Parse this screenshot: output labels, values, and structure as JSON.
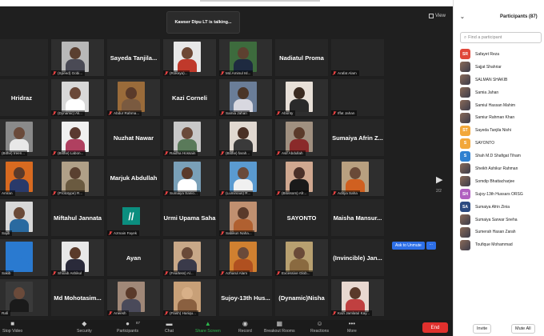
{
  "stage": {
    "talking": "Kawser Dipu LT is talking...",
    "view_label": "View",
    "page_count": "2/2",
    "ask_to_unmute": "Ask to Unmute",
    "more": "..."
  },
  "tiles": [
    {
      "name": "",
      "type": "blank"
    },
    {
      "name": "(Speed) Gobi...",
      "type": "photo",
      "bg": "#b8b8b8",
      "head": "#5a3f30",
      "body": "#4a4a55"
    },
    {
      "name": "Sayeda Tanjila...",
      "type": "text"
    },
    {
      "name": "(Rokeya)...",
      "type": "photo",
      "bg": "#e8e8e8",
      "head": "#6d4835",
      "body": "#c0392b"
    },
    {
      "name": "Md.Aminul Isl...",
      "type": "photo",
      "bg": "#3d6b3d",
      "head": "#5d4030",
      "body": "#1e2a40"
    },
    {
      "name": "Nadiatul Proma",
      "type": "text"
    },
    {
      "name": "Arafat Alam",
      "type": "blank"
    },
    {
      "name": "Hridraz",
      "type": "text"
    },
    {
      "name": "(Dynamic) Ali...",
      "type": "photo",
      "bg": "#d8d8d8",
      "head": "#6a4838",
      "body": "#ffffff"
    },
    {
      "name": "Abdur Rahma...",
      "type": "photo",
      "bg": "#9a6b3a",
      "head": "#5a3a2a",
      "body": "#7a5a40"
    },
    {
      "name": "Kazi Corneli",
      "type": "text"
    },
    {
      "name": "Samia Jahan",
      "type": "photo",
      "bg": "#6a7d98",
      "head": "#4a3528",
      "body": "#d8d8e0"
    },
    {
      "name": "Abonty",
      "type": "photo",
      "bg": "#e8e0d8",
      "head": "#3a2a20",
      "body": "#2a2a2a"
    },
    {
      "name": "Iffat Jahan",
      "type": "blank"
    },
    {
      "name": "(Bithe) Ireen...",
      "type": "photo",
      "bg": "#8a8a8a",
      "head": "#6a4a3a",
      "body": "#e8e8e8"
    },
    {
      "name": "(Blithe) Labon...",
      "type": "photo",
      "bg": "#f0f0f0",
      "head": "#5a3a30",
      "body": "#b04060"
    },
    {
      "name": "Nuzhat Nawar",
      "type": "text"
    },
    {
      "name": "Raidha Hossain",
      "type": "photo",
      "bg": "#c8c8c8",
      "head": "#6a4a3a",
      "body": "#5a7a5a"
    },
    {
      "name": "(Blithe) farah...",
      "type": "photo",
      "bg": "#e0d8d0",
      "head": "#4a3025",
      "body": "#3a3a3a"
    },
    {
      "name": "Asif Abdullah",
      "type": "photo",
      "bg": "#a09080",
      "head": "#5a3a2a",
      "body": "#8a2a2a"
    },
    {
      "name": "Sumaiya Afrin Z...",
      "type": "text"
    },
    {
      "name": "Amran",
      "type": "photo",
      "bg": "#d86a20",
      "head": "#5a3a2a",
      "body": "#2a3a6a"
    },
    {
      "name": "(Prototype) R...",
      "type": "photo",
      "bg": "#b0a088",
      "head": "#5a4030",
      "body": "#6a5a40"
    },
    {
      "name": "Marjuk Abdullah",
      "type": "text"
    },
    {
      "name": "Sumaiya Sanio...",
      "type": "photo",
      "bg": "#7aa0b8",
      "head": "#5a3a2a",
      "body": "#ffffff"
    },
    {
      "name": "(Luminous) R...",
      "type": "photo",
      "bg": "#5a9ad0",
      "head": "#6a4a3a",
      "body": "#f0f0f0"
    },
    {
      "name": "(Blossom) Afr...",
      "type": "photo",
      "bg": "#d0a890",
      "head": "#4a3028",
      "body": "#1a1a1a"
    },
    {
      "name": "Aditya Saha",
      "type": "photo",
      "bg": "#b8a080",
      "head": "#6a4a38",
      "body": "#d06020"
    },
    {
      "name": "Sajib",
      "type": "photo",
      "bg": "#d8d8d8",
      "head": "#6a4a38",
      "body": "#2a6aa0"
    },
    {
      "name": "Miftahul Jannata",
      "type": "text"
    },
    {
      "name": "Azmain Fayek",
      "type": "logo"
    },
    {
      "name": "Urmi Upama Saha",
      "type": "text"
    },
    {
      "name": "Sabikun Naha...",
      "type": "photo",
      "bg": "#c09070",
      "head": "#5a3a2a",
      "body": "#b06030"
    },
    {
      "name": "SAYONTO",
      "type": "text"
    },
    {
      "name": "Maisha Mansur...",
      "type": "text"
    },
    {
      "name": "Sakib",
      "type": "photo",
      "bg": "#2a7ad0",
      "head": "#2a7ad0",
      "body": "#2a7ad0"
    },
    {
      "name": "Shoaib Ashikul",
      "type": "photo",
      "bg": "#e8e8e8",
      "head": "#5a3a2a",
      "body": "#2a2a3a"
    },
    {
      "name": "Ayan",
      "type": "text"
    },
    {
      "name": "(Fearless) Al...",
      "type": "photo",
      "bg": "#c8a888",
      "head": "#6a4a38",
      "body": "#3a3a4a"
    },
    {
      "name": "Azharul Alam",
      "type": "photo",
      "bg": "#d08030",
      "head": "#6a4a3a",
      "body": "#b05020"
    },
    {
      "name": "Excessive Glob...",
      "type": "photo",
      "bg": "#b8a070",
      "head": "#6a4a38",
      "body": "#8a6a40"
    },
    {
      "name": "(Invincible) Jan...",
      "type": "text"
    },
    {
      "name": "Rafi",
      "type": "photo",
      "bg": "#3a3a3a",
      "head": "#6a4a3a",
      "body": "#1a1a1a"
    },
    {
      "name": "Md Mohotasim...",
      "type": "text"
    },
    {
      "name": "Aneesh",
      "type": "photo",
      "bg": "#a08878",
      "head": "#5a3a2a",
      "body": "#4a4a5a"
    },
    {
      "name": "(Flash) Hariqu...",
      "type": "photo",
      "bg": "#c8a078",
      "head": "#d8b088",
      "body": "#8a6040"
    },
    {
      "name": "Sujoy-13th Hus...",
      "type": "text"
    },
    {
      "name": "(Dynamic)Nisha",
      "type": "text"
    },
    {
      "name": "Kazi Jamlatul Kay...",
      "type": "photo",
      "bg": "#e8d8d0",
      "head": "#5a3a2a",
      "body": "#c04040"
    }
  ],
  "toolbar": {
    "items": [
      {
        "label": "Stop Video",
        "icon": "video-icon"
      },
      {
        "label": "Security",
        "icon": "shield-icon"
      },
      {
        "label": "Participants",
        "icon": "participants-icon",
        "count": "87"
      },
      {
        "label": "Chat",
        "icon": "chat-icon"
      },
      {
        "label": "Share Screen",
        "icon": "share-screen-icon"
      },
      {
        "label": "Record",
        "icon": "record-icon"
      },
      {
        "label": "Breakout Rooms",
        "icon": "breakout-rooms-icon"
      },
      {
        "label": "Reactions",
        "icon": "reactions-icon"
      },
      {
        "label": "More",
        "icon": "more-icon"
      }
    ],
    "end_label": "End"
  },
  "panel": {
    "title": "Participants (87)",
    "search_placeholder": "Find a participant",
    "invite": "Invite",
    "mute_all": "Mute All",
    "participants": [
      {
        "name": "Safayet Reza",
        "initials": "SR",
        "color": "#e0483a"
      },
      {
        "name": "Sajjat Shahriar",
        "initials": "",
        "color": ""
      },
      {
        "name": "SALMAN SHAKIB",
        "initials": "",
        "color": ""
      },
      {
        "name": "Samia Jahan",
        "initials": "",
        "color": ""
      },
      {
        "name": "Samiul Hassan Mahim",
        "initials": "",
        "color": ""
      },
      {
        "name": "Samiur Rahman Khan",
        "initials": "",
        "color": ""
      },
      {
        "name": "Sayeda Tanjila Nishi",
        "initials": "ST",
        "color": "#f2a73a"
      },
      {
        "name": "SAYONTO",
        "initials": "S",
        "color": "#f2a73a"
      },
      {
        "name": "Shah M.D Shafigat Tiham",
        "initials": "S",
        "color": "#2f80d0"
      },
      {
        "name": "Sheikh Ashikur Rahman",
        "initials": "",
        "color": ""
      },
      {
        "name": "Somdip Bhattacharjee",
        "initials": "",
        "color": ""
      },
      {
        "name": "Sujoy-13th Hussars ORSG",
        "initials": "SH",
        "color": "#b060c0"
      },
      {
        "name": "Sumaiya Afrin Zinia",
        "initials": "SA",
        "color": "#2c4a80"
      },
      {
        "name": "Sumaiya Sarwar Sneha",
        "initials": "",
        "color": ""
      },
      {
        "name": "Sumerah Hasan Zarah",
        "initials": "",
        "color": ""
      },
      {
        "name": "Toufique Mohammad",
        "initials": "",
        "color": ""
      }
    ]
  }
}
